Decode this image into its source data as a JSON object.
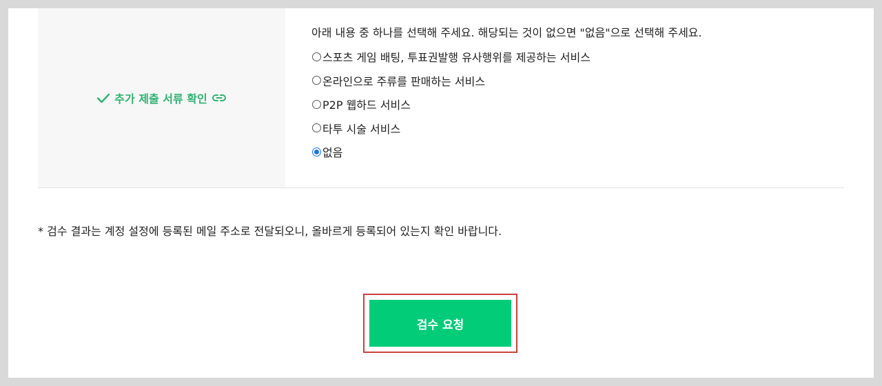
{
  "label": {
    "text": "추가 제출 서류 확인",
    "check_icon": "check-icon",
    "link_icon": "link-icon"
  },
  "question": {
    "instruction": "아래 내용 중 하나를 선택해 주세요. 해당되는 것이 없으면 \"없음\"으로 선택해 주세요.",
    "options": [
      {
        "label": "스포츠 게임 배팅, 투표권발행 유사행위를 제공하는 서비스",
        "checked": false
      },
      {
        "label": "온라인으로 주류를 판매하는 서비스",
        "checked": false
      },
      {
        "label": "P2P 웹하드 서비스",
        "checked": false
      },
      {
        "label": "타투 시술 서비스",
        "checked": false
      },
      {
        "label": "없음",
        "checked": true
      }
    ]
  },
  "note": "* 검수 결과는 계정 설정에 등록된 메일 주소로 전달되오니, 올바르게 등록되어 있는지 확인 바랍니다.",
  "submit": {
    "label": "검수 요청"
  },
  "colors": {
    "accent_green": "#2fb372",
    "button_green": "#02cc78",
    "highlight_red": "#c9413a",
    "radio_checked": "#1a73e8"
  }
}
